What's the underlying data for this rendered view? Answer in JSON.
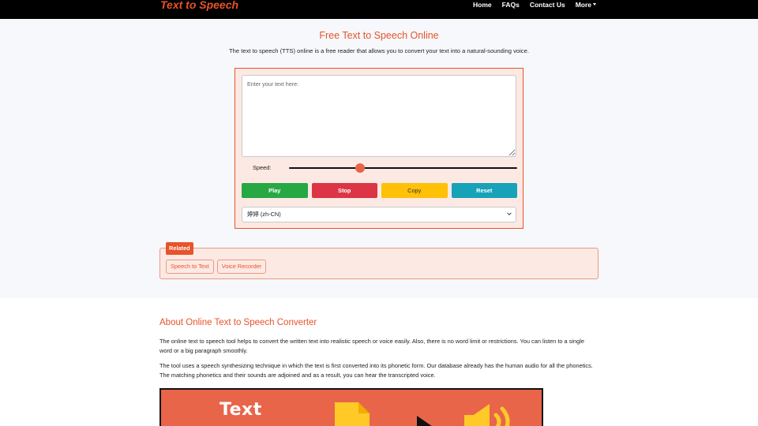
{
  "navbar": {
    "brand": "Text to Speech",
    "links": [
      {
        "label": "Home"
      },
      {
        "label": "FAQs"
      },
      {
        "label": "Contact Us"
      },
      {
        "label": "More"
      }
    ]
  },
  "hero": {
    "title": "Free Text to Speech Online",
    "subtitle": "The text to speech (TTS) online is a free reader that allows you to convert your text into a natural-sounding voice."
  },
  "tool": {
    "textarea_placeholder": "Enter your text here:",
    "speed_label": "Speed:",
    "speed_value": 0.31,
    "buttons": {
      "play": "Play",
      "stop": "Stop",
      "copy": "Copy",
      "reset": "Reset"
    },
    "voice_selected": "婷婷 (zh-CN)"
  },
  "related": {
    "badge": "Related",
    "links": [
      {
        "label": "Speech to Text"
      },
      {
        "label": "Voice Recorder"
      }
    ]
  },
  "about": {
    "title": "About Online Text to Speech Converter",
    "p1": "The online text to speech tool helps to convert the written text into realistic speech or voice easily. Also, there is no word limit or restrictions. You can listen to a single word or a big paragraph smoothly.",
    "p2": "The tool uses a speech synthesizing technique in which the text is first converted into its phonetic form. Our database already has the human audio for all the phonetics. The matching phonetics and their sounds are adjoined and as a result, you can hear the transcripted voice.",
    "banner_text": "Text"
  },
  "colors": {
    "accent": "#e8532a",
    "panel_bg": "#fde9e3",
    "play": "#28a745",
    "stop": "#dc3545",
    "copy": "#ffc107",
    "reset": "#17a2b8"
  },
  "icons": {
    "more_caret": "caret-down-icon",
    "select_chevron": "chevron-down-icon",
    "banner_document": "document-icon",
    "banner_play": "play-icon",
    "banner_speaker": "speaker-icon"
  }
}
